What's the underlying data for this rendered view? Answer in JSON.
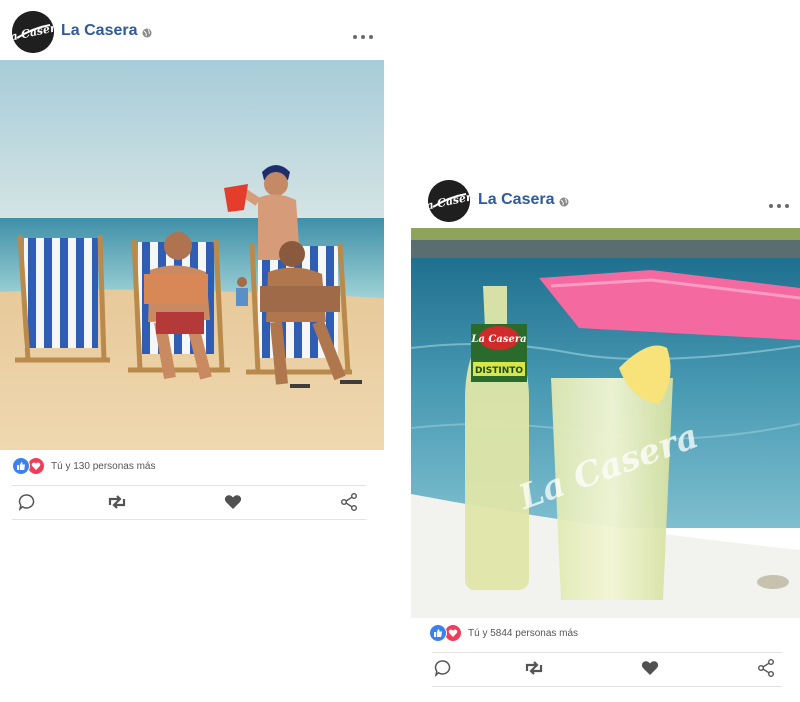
{
  "posts": [
    {
      "page_name": "La Casera",
      "avatar_text": "La Casera",
      "reaction_text": "Tú y 130 personas más",
      "icons": [
        "like-icon",
        "love-icon",
        "comment-icon",
        "share-retweet-icon",
        "heart-icon",
        "share-icon",
        "globe-icon",
        "more-icon"
      ]
    },
    {
      "page_name": "La Casera",
      "avatar_text": "La Casera",
      "reaction_text": "Tú y 5844 personas más",
      "bottle_label": "La Casera",
      "bottle_sublabel": "DISTINTO",
      "glass_logo": "La Casera",
      "icons": [
        "like-icon",
        "love-icon",
        "comment-icon",
        "share-retweet-icon",
        "heart-icon",
        "share-icon",
        "globe-icon",
        "more-icon"
      ]
    }
  ],
  "colors": {
    "brand_blue": "#2f5a9e",
    "like_blue": "#3b82f0",
    "love_red": "#ef3d5b"
  }
}
